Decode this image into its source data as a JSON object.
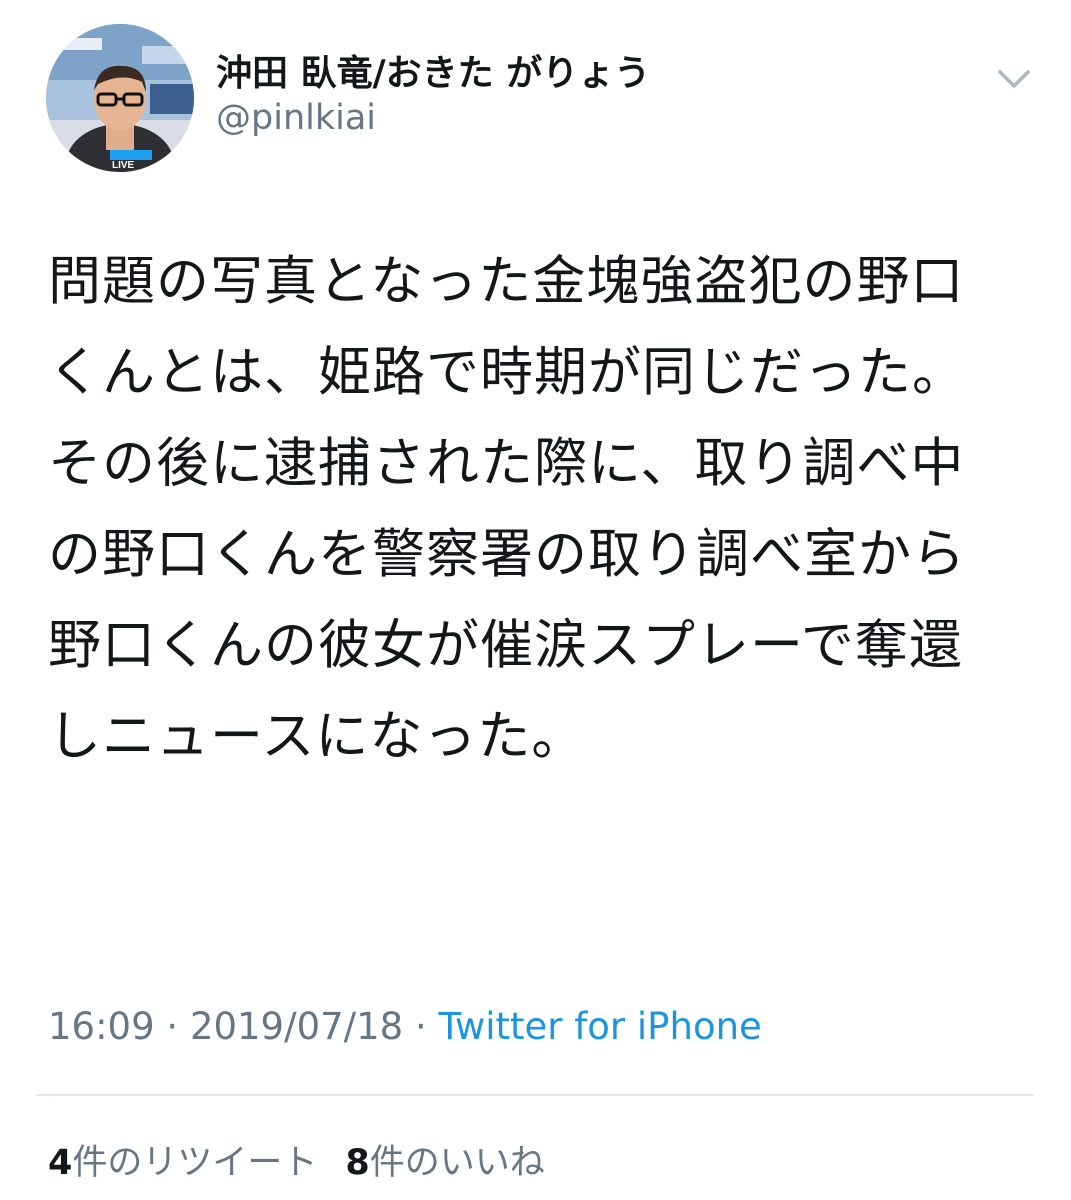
{
  "author": {
    "display_name": "沖田 臥竜/おきた がりょう",
    "handle": "@pinlkiai",
    "avatar_icon": "profile-photo",
    "avatar_overlay_text": "LIVE"
  },
  "tweet": {
    "text": "問題の写真となった金塊強盗犯の野口くんとは、姫路で時期が同じだった。\nその後に逮捕された際に、取り調べ中の野口くんを警察署の取り調べ室から野口くんの彼女が催涙スプレーで奪還しニュースになった。"
  },
  "meta": {
    "time": "16:09",
    "separator": " · ",
    "date": "2019/07/18",
    "source": "Twitter for iPhone"
  },
  "stats": {
    "retweets_count": "4",
    "retweets_label": "件のリツイート",
    "likes_count": "8",
    "likes_label": "件のいいね"
  },
  "colors": {
    "text": "#14171a",
    "secondary": "#657786",
    "link": "#1b95e0",
    "divider": "#e1e8ed"
  },
  "icons": {
    "menu": "chevron-down-icon"
  }
}
